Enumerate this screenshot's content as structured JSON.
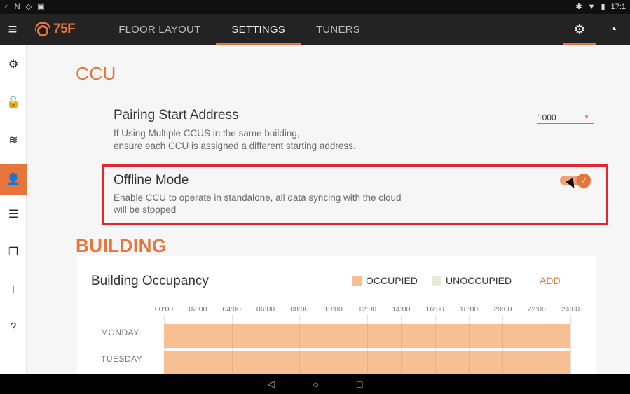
{
  "statusbar": {
    "left_icons": [
      "○",
      "N",
      "◇",
      "▣"
    ],
    "right_icons": [
      "✱",
      "▼",
      "▮"
    ],
    "time": "17:1"
  },
  "appbar": {
    "logo_text": "75F",
    "tabs": [
      {
        "label": "FLOOR LAYOUT",
        "active": false
      },
      {
        "label": "SETTINGS",
        "active": true
      },
      {
        "label": "TUNERS",
        "active": false
      }
    ],
    "icons": [
      "gear-icon",
      "dashboard-icon"
    ]
  },
  "rail": {
    "items": [
      {
        "name": "gear-icon",
        "glyph": "⚙",
        "active": false
      },
      {
        "name": "unlock-icon",
        "glyph": "🔓",
        "active": false
      },
      {
        "name": "wifi-icon",
        "glyph": "≋",
        "active": false
      },
      {
        "name": "user-settings-icon",
        "glyph": "👤",
        "active": true
      },
      {
        "name": "server-icon",
        "glyph": "☰",
        "active": false
      },
      {
        "name": "copy-icon",
        "glyph": "❐",
        "active": false
      },
      {
        "name": "network-icon",
        "glyph": "⊥",
        "active": false
      },
      {
        "name": "help-icon",
        "glyph": "?",
        "active": false
      }
    ]
  },
  "ccu": {
    "heading": "CCU",
    "pairing": {
      "title": "Pairing Start Address",
      "desc_line1": "If Using Multiple CCUS in the same building,",
      "desc_line2": "ensure each CCU is assigned a different starting address.",
      "value": "1000"
    },
    "offline": {
      "title": "Offline Mode",
      "desc_line1": "Enable CCU to operate in standalone, all data syncing with the cloud",
      "desc_line2": "will be stopped",
      "enabled": true
    }
  },
  "building": {
    "heading": "BUILDING",
    "occupancy": {
      "title": "Building Occupancy",
      "legend_occupied": "OCCUPIED",
      "legend_unoccupied": "UNOCCUPIED",
      "add_label": "ADD",
      "hours": [
        "00:00",
        "02:00",
        "04:00",
        "06:00",
        "08:00",
        "10:00",
        "12:00",
        "14:00",
        "16:00",
        "18:00",
        "20:00",
        "22:00",
        "24:00"
      ],
      "days": [
        "MONDAY",
        "TUESDAY"
      ],
      "occupied_color": "#f7bf92",
      "unoccupied_color": "#e6ecd5"
    }
  },
  "navbar": {
    "back": "◁",
    "home": "○",
    "recents": "□"
  },
  "colors": {
    "accent": "#e7743a",
    "highlight": "#e4262d"
  }
}
